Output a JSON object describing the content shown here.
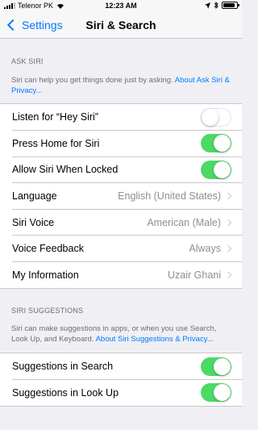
{
  "status_bar": {
    "carrier": "Telenor PK",
    "time": "12:23 AM",
    "battery_level": 0.9
  },
  "nav": {
    "back_label": "Settings",
    "title": "Siri & Search"
  },
  "ask_siri": {
    "header": "ASK SIRI",
    "footer_text": "Siri can help you get things done just by asking. ",
    "footer_link": "About Ask Siri & Privacy...",
    "rows": [
      {
        "label": "Listen for “Hey Siri”",
        "type": "toggle",
        "on": false
      },
      {
        "label": "Press Home for Siri",
        "type": "toggle",
        "on": true
      },
      {
        "label": "Allow Siri When Locked",
        "type": "toggle",
        "on": true
      },
      {
        "label": "Language",
        "type": "link",
        "value": "English (United States)"
      },
      {
        "label": "Siri Voice",
        "type": "link",
        "value": "American (Male)"
      },
      {
        "label": "Voice Feedback",
        "type": "link",
        "value": "Always"
      },
      {
        "label": "My Information",
        "type": "link",
        "value": "Uzair Ghani"
      }
    ]
  },
  "siri_suggestions": {
    "header": "SIRI SUGGESTIONS",
    "footer_text": "Siri can make suggestions in apps, or when you use Search, Look Up, and Keyboard. ",
    "footer_link": "About Siri Suggestions & Privacy...",
    "rows": [
      {
        "label": "Suggestions in Search",
        "type": "toggle",
        "on": true
      },
      {
        "label": "Suggestions in Look Up",
        "type": "toggle",
        "on": true
      }
    ]
  },
  "colors": {
    "accent": "#007aff",
    "toggle_on": "#4cd964",
    "background": "#efeff4"
  }
}
